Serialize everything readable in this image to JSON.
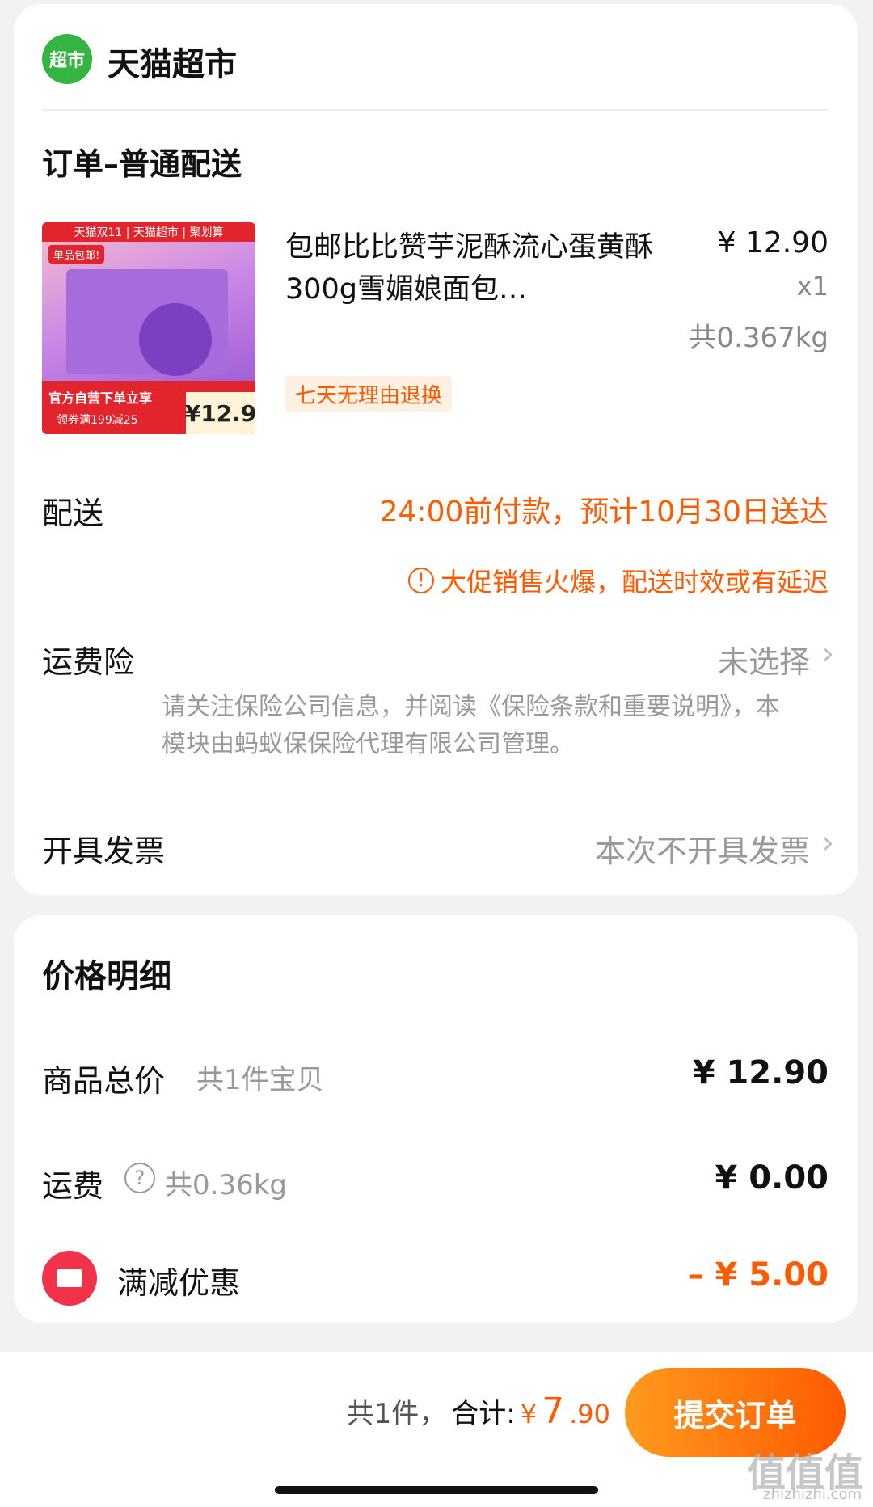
{
  "store": {
    "logo_text": "超市",
    "name": "天猫超市"
  },
  "order": {
    "section_title": "订单–普通配送",
    "product": {
      "title": "包邮比比赞芋泥酥流心蛋黄酥300g雪媚娘面包…",
      "price": "¥ 12.90",
      "qty": "x1",
      "weight": "共0.367kg",
      "return_tag": "七天无理由退换",
      "image": {
        "top_banner": "天猫双11 | 天猫超市 | 聚划算",
        "badge": "单品包邮!",
        "promo": "官方自营下单立享",
        "coupon": "领券满199减25",
        "price": "¥12.9"
      }
    },
    "delivery": {
      "label": "配送",
      "text": "24:00前付款，预计10月30日送达",
      "warning_icon": "!",
      "warning": "大促销售火爆，配送时效或有延迟"
    },
    "insurance": {
      "label": "运费险",
      "value": "未选择",
      "description": "请关注保险公司信息，并阅读《保险条款和重要说明》，本模块由蚂蚁保保险代理有限公司管理。"
    },
    "invoice": {
      "label": "开具发票",
      "value": "本次不开具发票"
    },
    "chevron": "›"
  },
  "price_detail": {
    "title": "价格明细",
    "subtotal_label": "商品总价",
    "subtotal_count": "共1件宝贝",
    "subtotal_value": "¥ 12.90",
    "shipping_label": "运费",
    "shipping_help": "?",
    "shipping_weight": "共0.36kg",
    "shipping_value": "¥ 0.00",
    "discount_label": "满减优惠",
    "discount_value": "– ¥ 5.00"
  },
  "footer": {
    "count": "共1件，",
    "total_label": "合计:",
    "currency": "¥",
    "total_int": "7",
    "total_dec": ".90",
    "submit_label": "提交订单"
  },
  "watermark": {
    "main": "值值值",
    "sub": "zhizhizhi.com"
  },
  "colors": {
    "accent": "#ff5a00",
    "store_green": "#34b441",
    "discount_red": "#f0324a"
  }
}
